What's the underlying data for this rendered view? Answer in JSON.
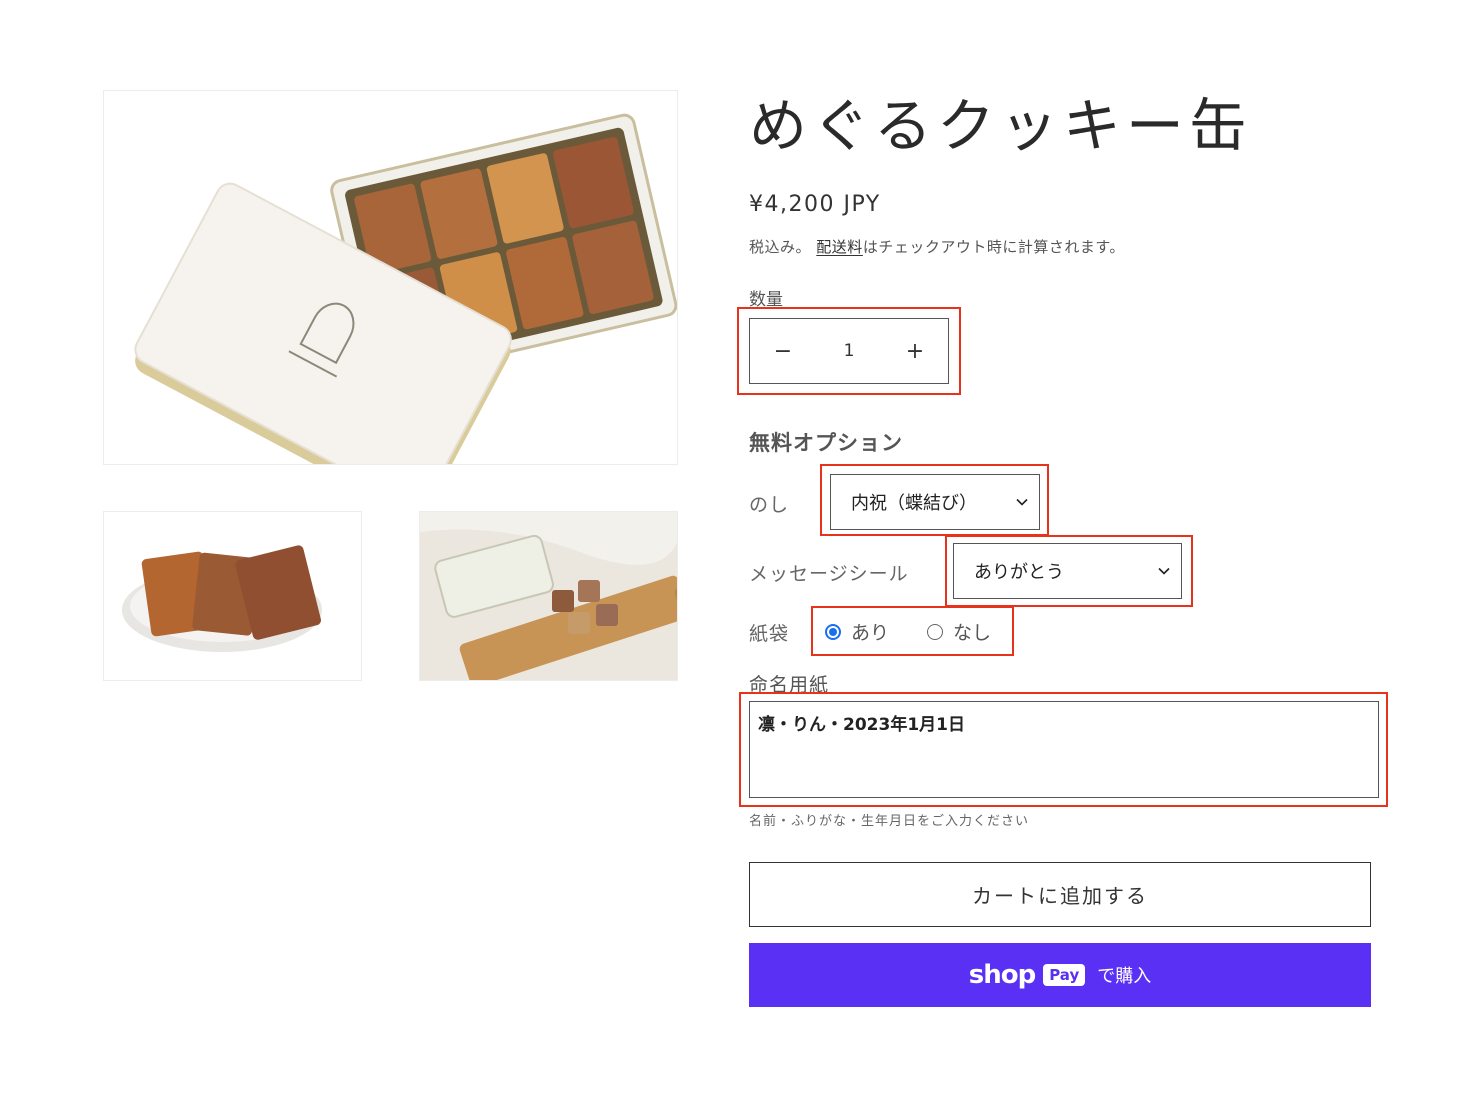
{
  "product": {
    "title": "めぐるクッキー缶",
    "price": "¥4,200 JPY",
    "tax_note_prefix": "税込み。",
    "tax_note_link": "配送料",
    "tax_note_suffix": "はチェックアウト時に計算されます。",
    "images": [
      {
        "icon": "cookie-tin-photo"
      },
      {
        "icon": "cookies-on-plate-photo"
      },
      {
        "icon": "tin-on-board-photo"
      }
    ]
  },
  "quantity": {
    "label": "数量",
    "value": "1",
    "decrement": "−",
    "increment": "+"
  },
  "options": {
    "heading": "無料オプション",
    "noshi": {
      "label": "のし",
      "value": "内祝（蝶結び）"
    },
    "seal": {
      "label": "メッセージシール",
      "value": "ありがとう"
    },
    "bag": {
      "label": "紙袋",
      "yes": "あり",
      "no": "なし",
      "selected": "あり"
    },
    "name_card": {
      "label": "命名用紙",
      "value": "凛・りん・2023年1月1日",
      "hint": "名前・ふりがな・生年月日をご入力ください"
    }
  },
  "buttons": {
    "add_to_cart": "カートに追加する",
    "shop_word": "shop",
    "pay_badge": "Pay",
    "buy_with": "で購入"
  },
  "colors": {
    "highlight": "#e8331c",
    "shop_pay": "#5a31f4",
    "radio_selected": "#1a6ff0"
  }
}
